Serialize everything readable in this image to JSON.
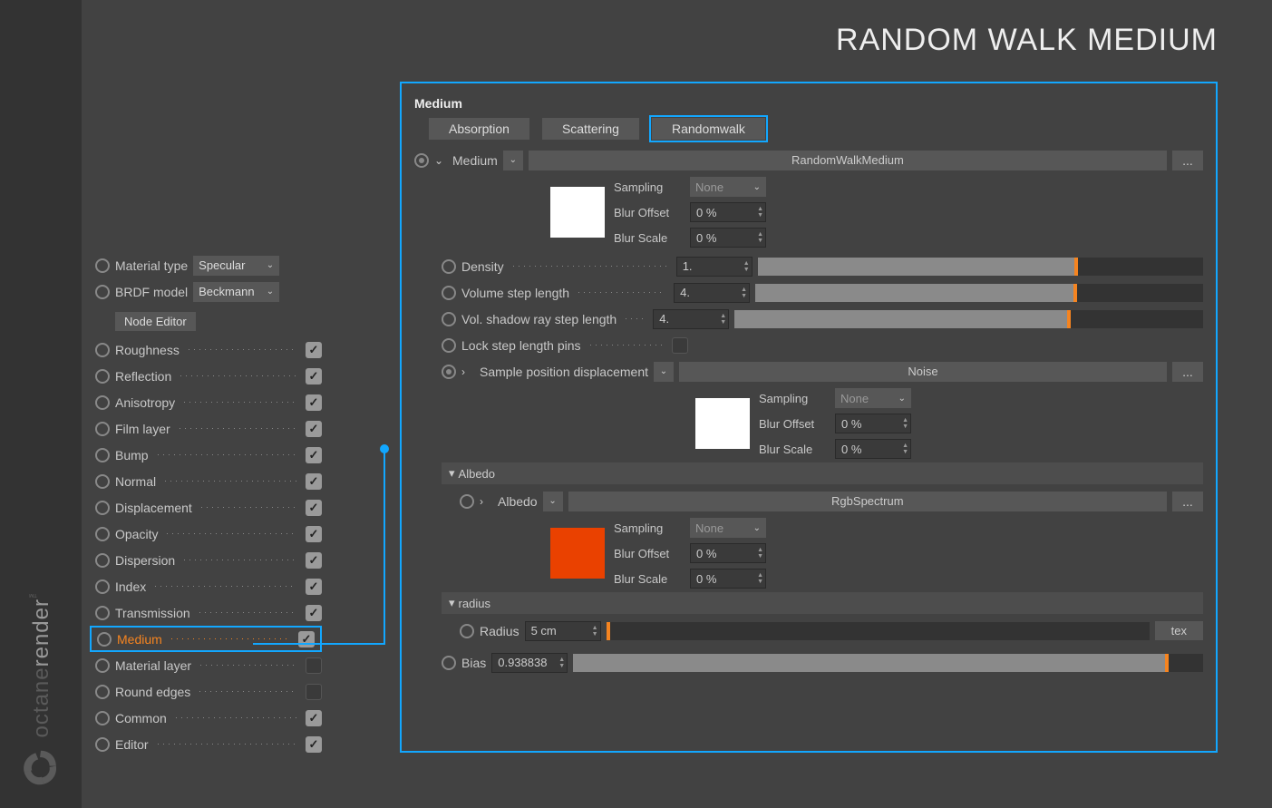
{
  "title": "RANDOM WALK MEDIUM",
  "logo": {
    "brand": "octane",
    "suffix": "render",
    "tm": "™"
  },
  "sidebar": {
    "material_type_label": "Material type",
    "material_type_value": "Specular",
    "brdf_label": "BRDF model",
    "brdf_value": "Beckmann",
    "node_editor_label": "Node Editor",
    "rows": [
      {
        "label": "Roughness",
        "checked": true
      },
      {
        "label": "Reflection",
        "checked": true
      },
      {
        "label": "Anisotropy",
        "checked": true
      },
      {
        "label": "Film layer",
        "checked": true
      },
      {
        "label": "Bump",
        "checked": true
      },
      {
        "label": "Normal",
        "checked": true
      },
      {
        "label": "Displacement",
        "checked": true
      },
      {
        "label": "Opacity",
        "checked": true
      },
      {
        "label": "Dispersion",
        "checked": true
      },
      {
        "label": "Index",
        "checked": true
      },
      {
        "label": "Transmission",
        "checked": true
      },
      {
        "label": "Medium",
        "checked": true,
        "highlight": true
      },
      {
        "label": "Material layer",
        "checked": false
      },
      {
        "label": "Round edges",
        "checked": false
      },
      {
        "label": "Common",
        "checked": true
      },
      {
        "label": "Editor",
        "checked": true
      }
    ]
  },
  "panel": {
    "header": "Medium",
    "tabs": [
      "Absorption",
      "Scattering",
      "Randomwalk"
    ],
    "active_tab": "Randomwalk",
    "medium_label": "Medium",
    "medium_value": "RandomWalkMedium",
    "more": "...",
    "sampling_label": "Sampling",
    "sampling_value": "None",
    "blur_offset_label": "Blur Offset",
    "blur_offset_value": "0 %",
    "blur_scale_label": "Blur Scale",
    "blur_scale_value": "0 %",
    "density_label": "Density",
    "density_value": "1.",
    "density_fill": 71,
    "vol_step_label": "Volume step length",
    "vol_step_value": "4.",
    "vol_step_fill": 71,
    "vol_shadow_label": "Vol. shadow ray step length",
    "vol_shadow_value": "4.",
    "vol_shadow_fill": 71,
    "lock_step_label": "Lock step length pins",
    "lock_step_checked": false,
    "sample_pos_label": "Sample position displacement",
    "sample_pos_value": "Noise",
    "albedo_section": "Albedo",
    "albedo_label": "Albedo",
    "albedo_value": "RgbSpectrum",
    "radius_section": "radius",
    "radius_label": "Radius",
    "radius_value": "5 cm",
    "radius_fill": 0,
    "tex_label": "tex",
    "bias_label": "Bias",
    "bias_value": "0.938838",
    "bias_fill": 94
  }
}
